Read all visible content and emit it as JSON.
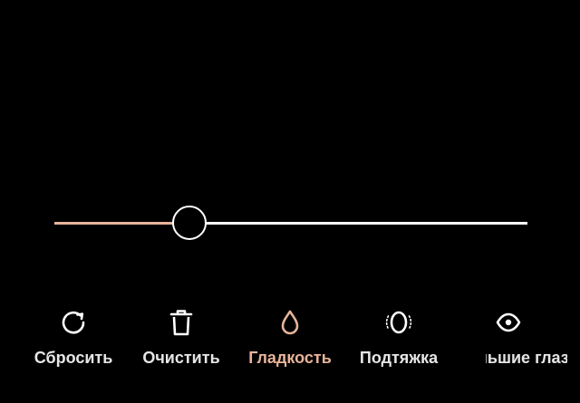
{
  "colors": {
    "background": "#000000",
    "accent": "#e8b49a",
    "track": "#ffffff",
    "label": "#e6e6e6"
  },
  "slider": {
    "value_fraction": 0.285
  },
  "tools": [
    {
      "label": "Сбросить",
      "icon": "reset-icon",
      "active": false
    },
    {
      "label": "Очистить",
      "icon": "trash-icon",
      "active": false
    },
    {
      "label": "Гладкость",
      "icon": "smooth-drop-icon",
      "active": true
    },
    {
      "label": "Подтяжка",
      "icon": "face-slim-icon",
      "active": false
    },
    {
      "label": "Большие глаза",
      "icon": "eye-icon",
      "active": false
    }
  ]
}
